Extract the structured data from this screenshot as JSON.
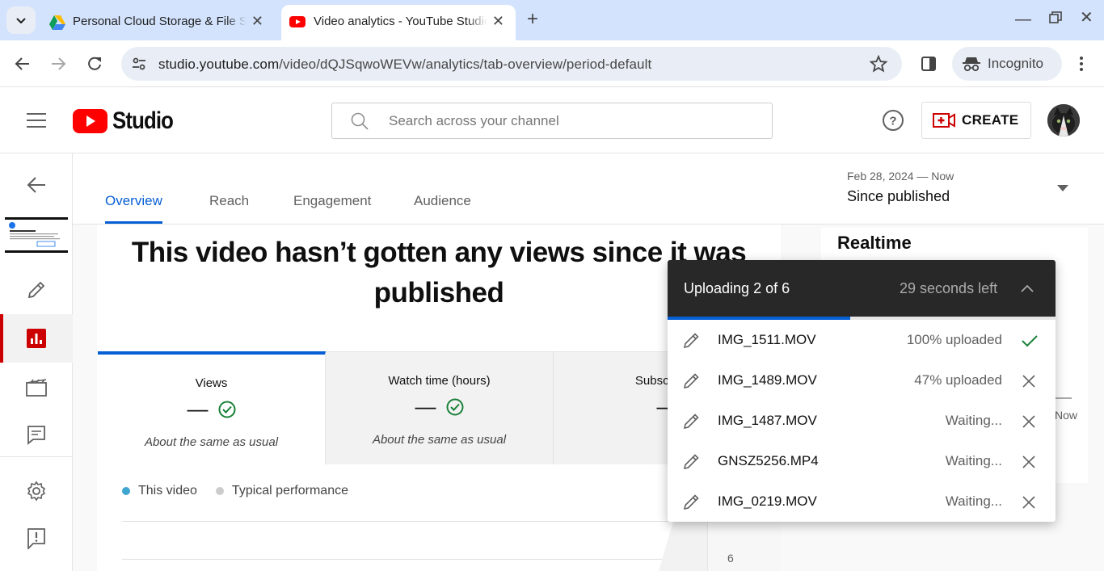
{
  "browser": {
    "tabs": [
      {
        "title": "Personal Cloud Storage & File Sharing",
        "icon": "google-drive-icon",
        "active": false
      },
      {
        "title": "Video analytics - YouTube Studio",
        "icon": "youtube-icon",
        "active": true
      }
    ],
    "url_host": "studio.youtube.com",
    "url_path": "/video/dQJSqwoWEVw/analytics/tab-overview/period-default",
    "incognito_label": "Incognito"
  },
  "studio": {
    "logo_text": "Studio",
    "search_placeholder": "Search across your channel",
    "create_label": "CREATE"
  },
  "analytics": {
    "tabs": [
      "Overview",
      "Reach",
      "Engagement",
      "Audience"
    ],
    "active_tab": "Overview",
    "period_range": "Feb 28, 2024 — Now",
    "period_label": "Since published",
    "headline": "This video hasn’t gotten any views since it was published",
    "metrics": [
      {
        "label": "Views",
        "value": "—",
        "note": "About the same as usual"
      },
      {
        "label": "Watch time (hours)",
        "value": "—",
        "note": "About the same as usual"
      },
      {
        "label": "Subscribers",
        "value": "—",
        "note": ""
      }
    ],
    "legend": [
      "This video",
      "Typical performance"
    ],
    "chart_tick": "6",
    "realtime_title": "Realtime",
    "realtime_partial": "Now"
  },
  "upload": {
    "title": "Uploading 2 of 6",
    "time_left": "29 seconds left",
    "progress_fraction": 0.47,
    "items": [
      {
        "name": "IMG_1511.MOV",
        "status": "100% uploaded",
        "done": true
      },
      {
        "name": "IMG_1489.MOV",
        "status": "47% uploaded",
        "done": false
      },
      {
        "name": "IMG_1487.MOV",
        "status": "Waiting...",
        "done": false
      },
      {
        "name": "GNSZ5256.MP4",
        "status": "Waiting...",
        "done": false
      },
      {
        "name": "IMG_0219.MOV",
        "status": "Waiting...",
        "done": false
      }
    ]
  },
  "colors": {
    "accent_blue": "#065fd4",
    "youtube_red": "#ff0000",
    "nav_active_red": "#cc0000",
    "check_green": "#188038",
    "tabstrip": "#d3e3fd"
  }
}
